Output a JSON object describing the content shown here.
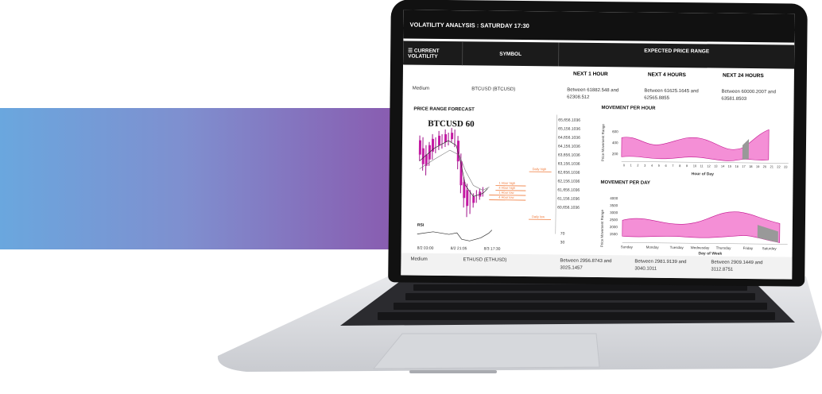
{
  "header": {
    "title": "VOLATILITY ANALYSIS : SATURDAY 17:30"
  },
  "columns": {
    "current_volatility": "☰ CURRENT VOLATILITY",
    "symbol": "SYMBOL",
    "expected": "EXPECTED PRICE RANGE"
  },
  "subheaders": [
    "NEXT 1 HOUR",
    "NEXT 4 HOURS",
    "NEXT 24 HOURS"
  ],
  "rows": [
    {
      "volatility": "Medium",
      "symbol": "BTCUSD (BTCUSD)",
      "r1": "Between 61882.548 and 62308.512",
      "r4": "Between 61625.1645 and 62565.8855",
      "r24": "Between 60000.2007 and 63581.8503"
    },
    {
      "volatility": "Medium",
      "symbol": "ETHUSD (ETHUSD)",
      "r1": "Between 2956.8743 and 3025.1457",
      "r4": "Between 2981.9139 and 3040.1011",
      "r24": "Between 2909.1449 and 3112.8751"
    }
  ],
  "forecast": {
    "title": "PRICE RANGE FORECAST",
    "chart_title": "BTCUSD 60",
    "price_ticks": [
      "65,656.1036",
      "65,156.1036",
      "64,656.1036",
      "64,156.1036",
      "63,656.1036",
      "63,156.1036",
      "62,656.1036",
      "62,156.1036",
      "61,656.1036",
      "61,156.1036",
      "60,656.1036"
    ],
    "annotations": [
      "Daily high",
      "1 Hour high",
      "1 Hour low",
      "4 Hour high",
      "4 Hour low",
      "Daily low"
    ],
    "rsi_label": "RSI",
    "rsi_ticks": [
      "70",
      "30"
    ],
    "time_ticks": [
      "8/2 03:00",
      "8/2 21:05",
      "8/3 17:30"
    ]
  },
  "hour_chart": {
    "title": "MOVEMENT PER HOUR",
    "ylabel": "Price Movement Range",
    "xlabel": "Hour of Day",
    "yticks": [
      "600",
      "400",
      "200"
    ],
    "xticks": [
      "0",
      "1",
      "2",
      "3",
      "4",
      "5",
      "6",
      "7",
      "8",
      "9",
      "10",
      "11",
      "12",
      "13",
      "14",
      "15",
      "16",
      "17",
      "18",
      "19",
      "20",
      "21",
      "22",
      "23"
    ]
  },
  "day_chart": {
    "title": "MOVEMENT PER DAY",
    "ylabel": "Price Movement Range",
    "xlabel": "Day of Week",
    "yticks": [
      "4000",
      "3500",
      "3000",
      "2500",
      "2000",
      "1500"
    ],
    "xticks": [
      "Sunday",
      "Monday",
      "Tuesday",
      "Wednesday",
      "Thursday",
      "Friday",
      "Saturday"
    ]
  },
  "colors": {
    "band_start": "#6aa7de",
    "band_end": "#8a57ad",
    "range_fill": "#f48fd6",
    "current_fill": "#999999",
    "accent_orange": "#f07a3a"
  }
}
